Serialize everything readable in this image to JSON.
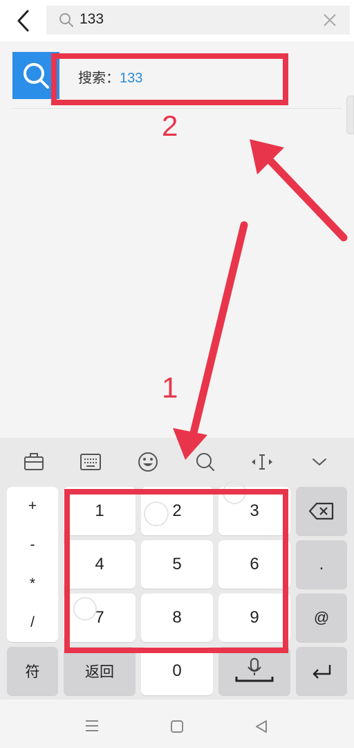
{
  "search": {
    "query": "133"
  },
  "suggestion": {
    "label": "搜索：",
    "keyword": "133"
  },
  "annotations": {
    "label_1": "1",
    "label_2": "2",
    "color": "#e8354b"
  },
  "keyboard": {
    "toolbar_icons": [
      "toolbox-icon",
      "keyboard-icon",
      "emoji-icon",
      "search-icon",
      "cursor-move-icon",
      "chevron-down-icon"
    ],
    "symbols": [
      "+",
      "-",
      "*",
      "/"
    ],
    "digits": [
      "1",
      "2",
      "3",
      "4",
      "5",
      "6",
      "7",
      "8",
      "9"
    ],
    "right_keys": {
      "dot": ".",
      "at": "@"
    },
    "bottom": {
      "symbol_key": "符",
      "return_key": "返回",
      "zero": "0"
    }
  },
  "colors": {
    "accent_blue": "#2b8ee8",
    "keyword_blue": "#2a8ad8",
    "annotation_red": "#e8354b"
  }
}
